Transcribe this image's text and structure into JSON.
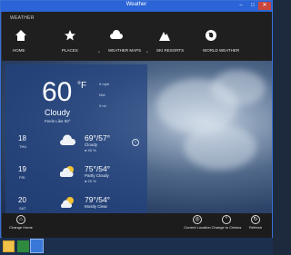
{
  "window": {
    "title": "Weather"
  },
  "nav": {
    "app_label": "WEATHER",
    "items": [
      {
        "label": "HOME",
        "icon": "home-icon"
      },
      {
        "label": "PLACES",
        "icon": "star-icon"
      },
      {
        "label": "WEATHER MAPS",
        "icon": "cloud-icon"
      },
      {
        "label": "SKI RESORTS",
        "icon": "mountain-icon"
      },
      {
        "label": "WORLD WEATHER",
        "icon": "globe-icon"
      }
    ]
  },
  "current": {
    "temp": "60",
    "unit": "°F",
    "condition": "Cloudy",
    "feels_like": "Feels Like 60°",
    "details": [
      "0 mph",
      "N/A",
      "0 mi"
    ]
  },
  "forecast": [
    {
      "date": "18",
      "day": "THU",
      "hilo": "69°/57°",
      "condition": "Cloudy",
      "precip": "● 40 %",
      "icon": "cloudy-icon"
    },
    {
      "date": "19",
      "day": "FRI",
      "hilo": "75°/54°",
      "condition": "Partly Cloudy",
      "precip": "● 20 %",
      "icon": "partly-cloudy-icon"
    },
    {
      "date": "20",
      "day": "SAT",
      "hilo": "79°/54°",
      "condition": "Mostly Clear",
      "precip": "",
      "icon": "partly-sunny-icon"
    }
  ],
  "appbar": {
    "left": {
      "label": "Change Home",
      "icon": "home-icon"
    },
    "right": [
      {
        "label": "Current Location",
        "icon": "location-icon"
      },
      {
        "label": "Change to Celsius",
        "icon": "celsius-icon"
      },
      {
        "label": "Refresh",
        "icon": "refresh-icon"
      }
    ]
  }
}
